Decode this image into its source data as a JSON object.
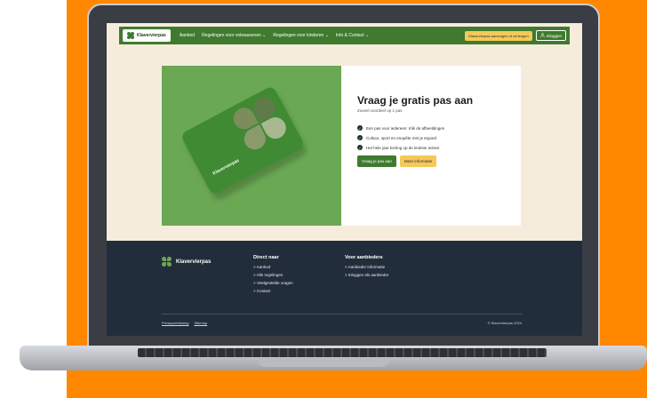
{
  "header": {
    "logo_text": "Klavervierpas",
    "nav": [
      {
        "label": "Aanbod"
      },
      {
        "label": "Regelingen voor volwassenen ⌄"
      },
      {
        "label": "Regelingen voor kinderen ⌄"
      },
      {
        "label": "Info & Contact ⌄"
      }
    ],
    "cta_label": "Klavervierpas aanvragen of verlengen",
    "login_label": "Inloggen"
  },
  "hero": {
    "title": "Vraag je gratis pas aan",
    "subtitle": "Zoveel voordeel op 1 pas",
    "card_text": "Klavervierpas",
    "benefits": [
      {
        "text": "Een pas voor iedereen: Klik de afbeeldingen"
      },
      {
        "text": "Cultuur, sport en enquête met je tegoed"
      },
      {
        "text": "Het hele jaar korting op de leukste acties!"
      }
    ],
    "primary_button": "Vraag je pas aan",
    "secondary_button": "Meer informatie"
  },
  "footer": {
    "logo_text": "Klavervierpas",
    "col1": {
      "heading": "Direct naar",
      "items": [
        "> Aanbod",
        "> Alle regelingen",
        "> Veelgestelde vragen",
        "> Contact"
      ]
    },
    "col2": {
      "heading": "Voor aanbieders",
      "items": [
        "> Aanbieder informatie",
        "> Inloggen als aanbieder"
      ]
    },
    "bottom_links": [
      "Privacyverklaring",
      "Sitemap"
    ],
    "copyright": "© Klavervierpas 2024"
  },
  "colors": {
    "brand_green": "#3f7a2e",
    "accent_yellow": "#f4c95a",
    "footer_bg": "#222d3c",
    "page_bg": "#f6ecdc",
    "backdrop_orange": "#ff8800"
  }
}
